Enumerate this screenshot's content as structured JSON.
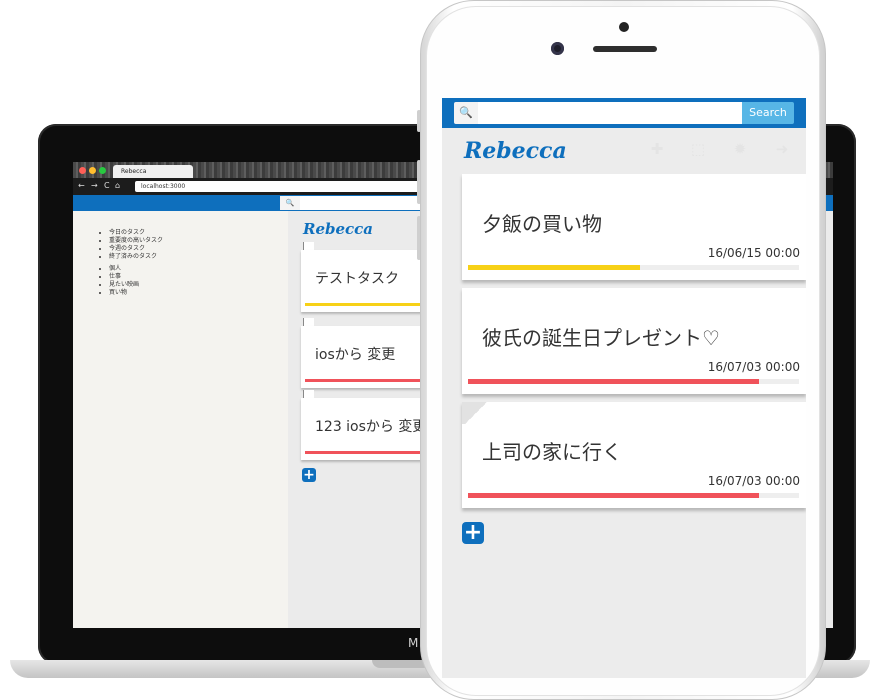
{
  "laptop": {
    "model_label": "M",
    "browser": {
      "tab_title": "Rebecca",
      "url": "localhost:3000",
      "nav": {
        "back": "←",
        "forward": "→",
        "reload": "C",
        "home": "⌂"
      },
      "traffic_lights": [
        "#ff5f57",
        "#ffbd2e",
        "#28c840"
      ]
    },
    "search_icon": "🔍",
    "logo": "Rebecca",
    "sidebar_menu_1": [
      "今日のタスク",
      "重要度の高いタスク",
      "今週のタスク",
      "終了済みのタスク"
    ],
    "sidebar_menu_2": [
      "個人",
      "仕事",
      "見たい映画",
      "買い物"
    ],
    "tasks": [
      {
        "title": "テストタスク",
        "bar_color": "#f7d117"
      },
      {
        "title": "iosから 変更",
        "bar_color": "#f0525a"
      },
      {
        "title": "123 iosから 変更",
        "bar_color": "#f0525a"
      }
    ],
    "add_label": "+"
  },
  "phone": {
    "search": {
      "icon": "🔍",
      "placeholder": "",
      "button_label": "Search"
    },
    "logo": "Rebecca",
    "header_icons": [
      "settings-icon",
      "trash-icon",
      "star-icon",
      "signout-icon"
    ],
    "header_icon_glyphs": [
      "✚",
      "⬚",
      "✹",
      "➜"
    ],
    "tasks": [
      {
        "title": "夕飯の買い物",
        "date": "16/06/15 00:00",
        "progress": 0.52,
        "bar_color": "#f7d117"
      },
      {
        "title": "彼氏の誕生日プレゼント♡",
        "date": "16/07/03 00:00",
        "progress": 0.88,
        "bar_color": "#f0525a"
      },
      {
        "title": "上司の家に行く",
        "date": "16/07/03 00:00",
        "progress": 0.88,
        "bar_color": "#f0525a"
      }
    ],
    "add_label": "+"
  }
}
